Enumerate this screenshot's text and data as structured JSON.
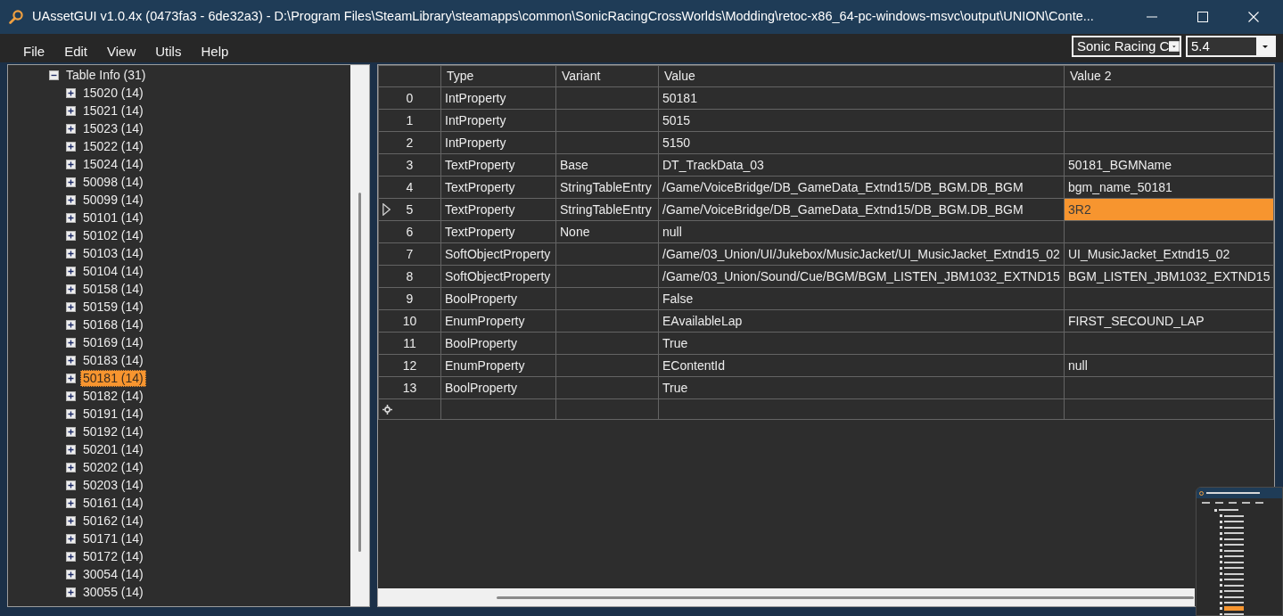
{
  "window": {
    "title": "UAssetGUI v1.0.4x (0473fa3 - 6de32a3) - D:\\Program Files\\SteamLibrary\\steamapps\\common\\SonicRacingCrossWorlds\\Modding\\retoc-x86_64-pc-windows-msvc\\output\\UNION\\Conte..."
  },
  "menu": [
    "File",
    "Edit",
    "View",
    "Utils",
    "Help"
  ],
  "selectors": [
    {
      "value": "Sonic Racing C"
    },
    {
      "value": "5.4"
    }
  ],
  "tree": {
    "items": [
      {
        "label": "Table Info (31)",
        "expanded": true,
        "selected": false,
        "children": [
          {
            "label": "15020 (14)",
            "expanded": false,
            "selected": false
          },
          {
            "label": "15021 (14)",
            "expanded": false,
            "selected": false
          },
          {
            "label": "15023 (14)",
            "expanded": false,
            "selected": false
          },
          {
            "label": "15022 (14)",
            "expanded": false,
            "selected": false
          },
          {
            "label": "15024 (14)",
            "expanded": false,
            "selected": false
          },
          {
            "label": "50098 (14)",
            "expanded": false,
            "selected": false
          },
          {
            "label": "50099 (14)",
            "expanded": false,
            "selected": false
          },
          {
            "label": "50101 (14)",
            "expanded": false,
            "selected": false
          },
          {
            "label": "50102 (14)",
            "expanded": false,
            "selected": false
          },
          {
            "label": "50103 (14)",
            "expanded": false,
            "selected": false
          },
          {
            "label": "50104 (14)",
            "expanded": false,
            "selected": false
          },
          {
            "label": "50158 (14)",
            "expanded": false,
            "selected": false
          },
          {
            "label": "50159 (14)",
            "expanded": false,
            "selected": false
          },
          {
            "label": "50168 (14)",
            "expanded": false,
            "selected": false
          },
          {
            "label": "50169 (14)",
            "expanded": false,
            "selected": false
          },
          {
            "label": "50183 (14)",
            "expanded": false,
            "selected": false
          },
          {
            "label": "50181 (14)",
            "expanded": false,
            "selected": true
          },
          {
            "label": "50182 (14)",
            "expanded": false,
            "selected": false
          },
          {
            "label": "50191 (14)",
            "expanded": false,
            "selected": false
          },
          {
            "label": "50192 (14)",
            "expanded": false,
            "selected": false
          },
          {
            "label": "50201 (14)",
            "expanded": false,
            "selected": false
          },
          {
            "label": "50202 (14)",
            "expanded": false,
            "selected": false
          },
          {
            "label": "50203 (14)",
            "expanded": false,
            "selected": false
          },
          {
            "label": "50161 (14)",
            "expanded": false,
            "selected": false
          },
          {
            "label": "50162 (14)",
            "expanded": false,
            "selected": false
          },
          {
            "label": "50171 (14)",
            "expanded": false,
            "selected": false
          },
          {
            "label": "50172 (14)",
            "expanded": false,
            "selected": false
          },
          {
            "label": "30054 (14)",
            "expanded": false,
            "selected": false
          },
          {
            "label": "30055 (14)",
            "expanded": false,
            "selected": false
          }
        ]
      }
    ]
  },
  "grid": {
    "columns": [
      "Type",
      "Variant",
      "Value",
      "Value 2"
    ],
    "rows": [
      {
        "number": "0",
        "current": false,
        "cells": [
          {
            "text": "IntProperty",
            "selected": false
          },
          {
            "selected": false
          },
          {
            "text": "50181",
            "selected": false
          },
          {
            "selected": false
          }
        ]
      },
      {
        "number": "1",
        "current": false,
        "cells": [
          {
            "text": "IntProperty",
            "selected": false
          },
          {
            "selected": false
          },
          {
            "text": "5015",
            "selected": false
          },
          {
            "selected": false
          }
        ]
      },
      {
        "number": "2",
        "current": false,
        "cells": [
          {
            "text": "IntProperty",
            "selected": false
          },
          {
            "selected": false
          },
          {
            "text": "5150",
            "selected": false
          },
          {
            "selected": false
          }
        ]
      },
      {
        "number": "3",
        "current": false,
        "cells": [
          {
            "text": "TextProperty",
            "selected": false
          },
          {
            "text": "Base",
            "selected": false
          },
          {
            "text": "DT_TrackData_03",
            "selected": false
          },
          {
            "text": "50181_BGMName",
            "selected": false
          }
        ]
      },
      {
        "number": "4",
        "current": false,
        "cells": [
          {
            "text": "TextProperty",
            "selected": false
          },
          {
            "text": "StringTableEntry",
            "selected": false
          },
          {
            "text": "/Game/VoiceBridge/DB_GameData_Extnd15/DB_BGM.DB_BGM",
            "selected": false
          },
          {
            "text": "bgm_name_50181",
            "selected": false
          }
        ]
      },
      {
        "number": "5",
        "current": true,
        "cells": [
          {
            "text": "TextProperty",
            "selected": false
          },
          {
            "text": "StringTableEntry",
            "selected": false
          },
          {
            "text": "/Game/VoiceBridge/DB_GameData_Extnd15/DB_BGM.DB_BGM",
            "selected": false
          },
          {
            "text": "3R2",
            "selected": true
          }
        ]
      },
      {
        "number": "6",
        "current": false,
        "cells": [
          {
            "text": "TextProperty",
            "selected": false
          },
          {
            "text": "None",
            "selected": false
          },
          {
            "text": "null",
            "selected": false
          },
          {
            "selected": false
          }
        ]
      },
      {
        "number": "7",
        "current": false,
        "cells": [
          {
            "text": "SoftObjectProperty",
            "selected": false
          },
          {
            "selected": false
          },
          {
            "text": "/Game/03_Union/UI/Jukebox/MusicJacket/UI_MusicJacket_Extnd15_02",
            "selected": false
          },
          {
            "text": "UI_MusicJacket_Extnd15_02",
            "selected": false
          }
        ]
      },
      {
        "number": "8",
        "current": false,
        "cells": [
          {
            "text": "SoftObjectProperty",
            "selected": false
          },
          {
            "selected": false
          },
          {
            "text": "/Game/03_Union/Sound/Cue/BGM/BGM_LISTEN_JBM1032_EXTND15",
            "selected": false
          },
          {
            "text": "BGM_LISTEN_JBM1032_EXTND15",
            "selected": false
          }
        ]
      },
      {
        "number": "9",
        "current": false,
        "cells": [
          {
            "text": "BoolProperty",
            "selected": false
          },
          {
            "selected": false
          },
          {
            "text": "False",
            "selected": false
          },
          {
            "selected": false
          }
        ]
      },
      {
        "number": "10",
        "current": false,
        "cells": [
          {
            "text": "EnumProperty",
            "selected": false
          },
          {
            "selected": false
          },
          {
            "text": "EAvailableLap",
            "selected": false
          },
          {
            "text": "FIRST_SECOUND_LAP",
            "selected": false
          }
        ]
      },
      {
        "number": "11",
        "current": false,
        "cells": [
          {
            "text": "BoolProperty",
            "selected": false
          },
          {
            "selected": false
          },
          {
            "text": "True",
            "selected": false
          },
          {
            "selected": false
          }
        ]
      },
      {
        "number": "12",
        "current": false,
        "cells": [
          {
            "text": "EnumProperty",
            "selected": false
          },
          {
            "selected": false
          },
          {
            "text": "EContentId",
            "selected": false
          },
          {
            "text": "null",
            "selected": false
          }
        ]
      },
      {
        "number": "13",
        "current": false,
        "cells": [
          {
            "text": "BoolProperty",
            "selected": false
          },
          {
            "selected": false
          },
          {
            "text": "True",
            "selected": false
          },
          {
            "selected": false
          }
        ]
      }
    ]
  }
}
